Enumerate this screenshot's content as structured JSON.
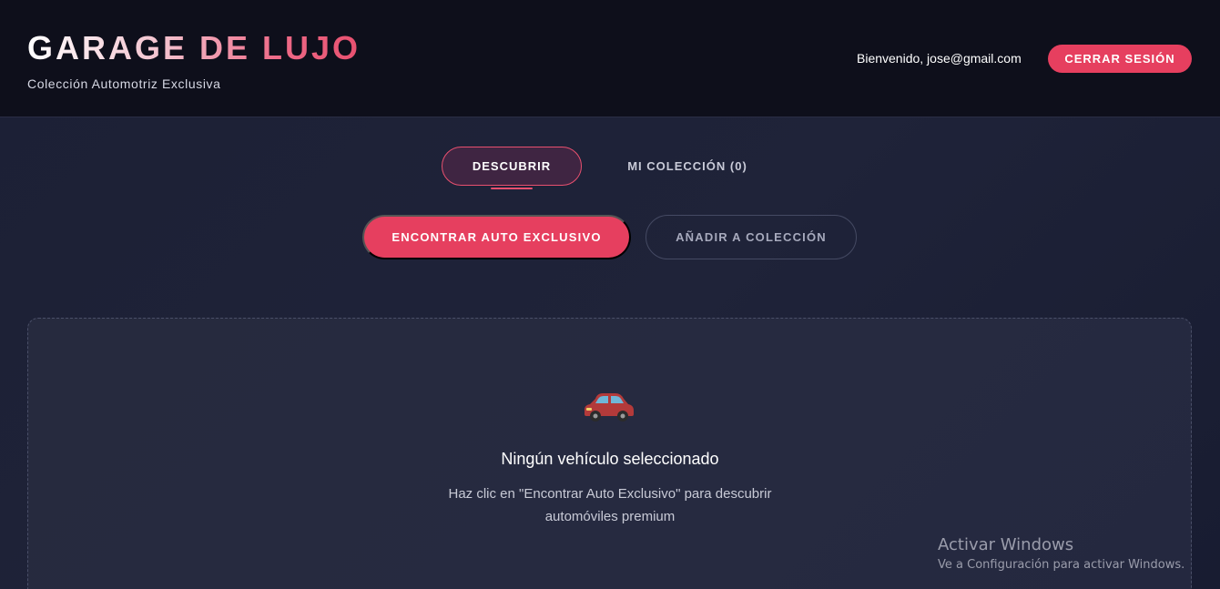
{
  "header": {
    "brand_title_part1": "GARAGE DE ",
    "brand_title_part2": "LUJO",
    "subtitle": "Colección Automotriz Exclusiva",
    "welcome_text": "Bienvenido, jose@gmail.com",
    "logout_label": "CERRAR SESIÓN"
  },
  "tabs": [
    {
      "label": "DESCUBRIR",
      "active": true
    },
    {
      "label": "MI COLECCIÓN (0)",
      "active": false
    }
  ],
  "actions": {
    "find_label": "ENCONTRAR AUTO EXCLUSIVO",
    "add_label": "AÑADIR A COLECCIÓN"
  },
  "empty_state": {
    "icon": "car-icon",
    "title": "Ningún vehículo seleccionado",
    "description": "Haz clic en \"Encontrar Auto Exclusivo\" para descubrir automóviles premium"
  },
  "watermark": {
    "title": "Activar Windows",
    "subtitle": "Ve a Configuración para activar Windows."
  },
  "colors": {
    "accent": "#e63f5f",
    "header_bg": "#0e0f1b",
    "page_bg": "#1c2035"
  }
}
